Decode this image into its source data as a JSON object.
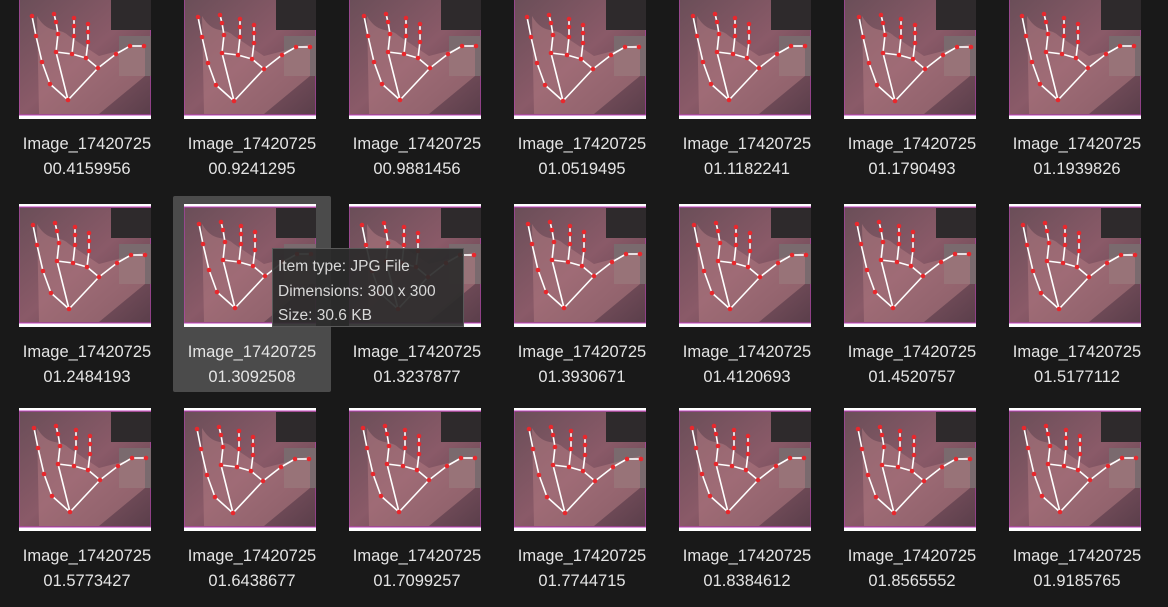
{
  "colors": {
    "background": "#191919",
    "hover_tile": "#4b4b4b",
    "label_text": "#e4e4e4",
    "landmark_red": "#e8282d",
    "connector_white": "#ffffff",
    "frame_magenta": "#c040c0"
  },
  "files": [
    {
      "line1": "Image_17420725",
      "line2": "00.4159956"
    },
    {
      "line1": "Image_17420725",
      "line2": "00.9241295"
    },
    {
      "line1": "Image_17420725",
      "line2": "00.9881456"
    },
    {
      "line1": "Image_17420725",
      "line2": "01.0519495"
    },
    {
      "line1": "Image_17420725",
      "line2": "01.1182241"
    },
    {
      "line1": "Image_17420725",
      "line2": "01.1790493"
    },
    {
      "line1": "Image_17420725",
      "line2": "01.1939826"
    },
    {
      "line1": "Image_17420725",
      "line2": "01.2484193"
    },
    {
      "line1": "Image_17420725",
      "line2": "01.3092508"
    },
    {
      "line1": "Image_17420725",
      "line2": "01.3237877"
    },
    {
      "line1": "Image_17420725",
      "line2": "01.3930671"
    },
    {
      "line1": "Image_17420725",
      "line2": "01.4120693"
    },
    {
      "line1": "Image_17420725",
      "line2": "01.4520757"
    },
    {
      "line1": "Image_17420725",
      "line2": "01.5177112"
    },
    {
      "line1": "Image_17420725",
      "line2": "01.5773427"
    },
    {
      "line1": "Image_17420725",
      "line2": "01.6438677"
    },
    {
      "line1": "Image_17420725",
      "line2": "01.7099257"
    },
    {
      "line1": "Image_17420725",
      "line2": "01.7744715"
    },
    {
      "line1": "Image_17420725",
      "line2": "01.8384612"
    },
    {
      "line1": "Image_17420725",
      "line2": "01.8565552"
    },
    {
      "line1": "Image_17420725",
      "line2": "01.9185765"
    }
  ],
  "tooltip": {
    "item_type": "Item type: JPG File",
    "dimensions": "Dimensions: 300 x 300",
    "size": "Size: 30.6 KB"
  }
}
